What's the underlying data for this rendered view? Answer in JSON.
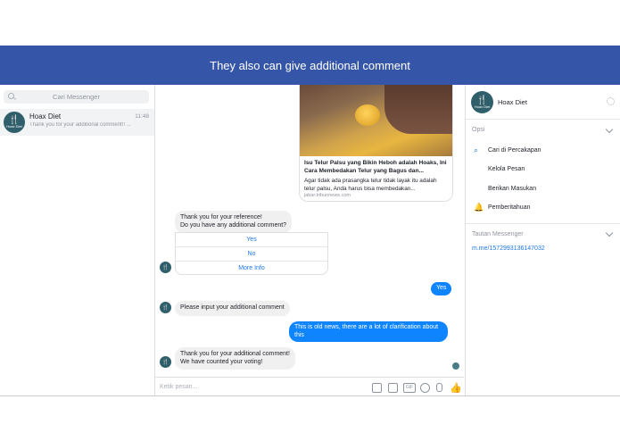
{
  "banner": {
    "title": "They also can give additional comment"
  },
  "sidebar": {
    "search_placeholder": "Cari Messenger",
    "conversations": [
      {
        "name": "Hoax Diet",
        "time": "11:48",
        "snippet": "Thank you for your additional comment!! ...",
        "avatar_label": "Hoax Diet"
      }
    ]
  },
  "chat": {
    "link_card": {
      "title": "Isu Telur Palsu yang Bikin Heboh adalah Hoaks, Ini Cara Membedakan Telur yang Bagus dan...",
      "description": "Agar tidak ada prasangka telur tidak layak itu adalah telur palsu, Anda harus bisa membedakan...",
      "domain": "jabar.tribunnews.com"
    },
    "messages": [
      {
        "from": "bot",
        "line1": "Thank you for your reference!",
        "line2": "Do you have any additional comment?"
      },
      {
        "from": "user",
        "text": "Yes"
      },
      {
        "from": "bot",
        "text": "Please input your additional comment"
      },
      {
        "from": "user",
        "text": "This is old news, there are a lot of clarification about this"
      },
      {
        "from": "bot",
        "line1": "Thank you for your additional comment!",
        "line2": "We have counted your voting!"
      }
    ],
    "quick_replies": [
      "Yes",
      "No",
      "More Info"
    ],
    "composer_placeholder": "Ketik pesan..."
  },
  "info_panel": {
    "name": "Hoax Diet",
    "options_header": "Opsi",
    "options": [
      "Cari di Percakapan",
      "Kelola Pesan",
      "Berikan Masukan",
      "Pemberitahuan"
    ],
    "links_header": "Tautan Messenger",
    "link": "m.me/1572993136147032"
  },
  "colors": {
    "banner": "#3556a8",
    "accent": "#1e77e6",
    "outgoing_bubble": "#0f84ff"
  },
  "icons": [
    "search-icon",
    "gear-icon",
    "chevron-down-icon",
    "bell-icon",
    "like-icon",
    "gif-icon",
    "sticker-icon",
    "emoji-icon",
    "mic-icon",
    "camera-icon"
  ]
}
